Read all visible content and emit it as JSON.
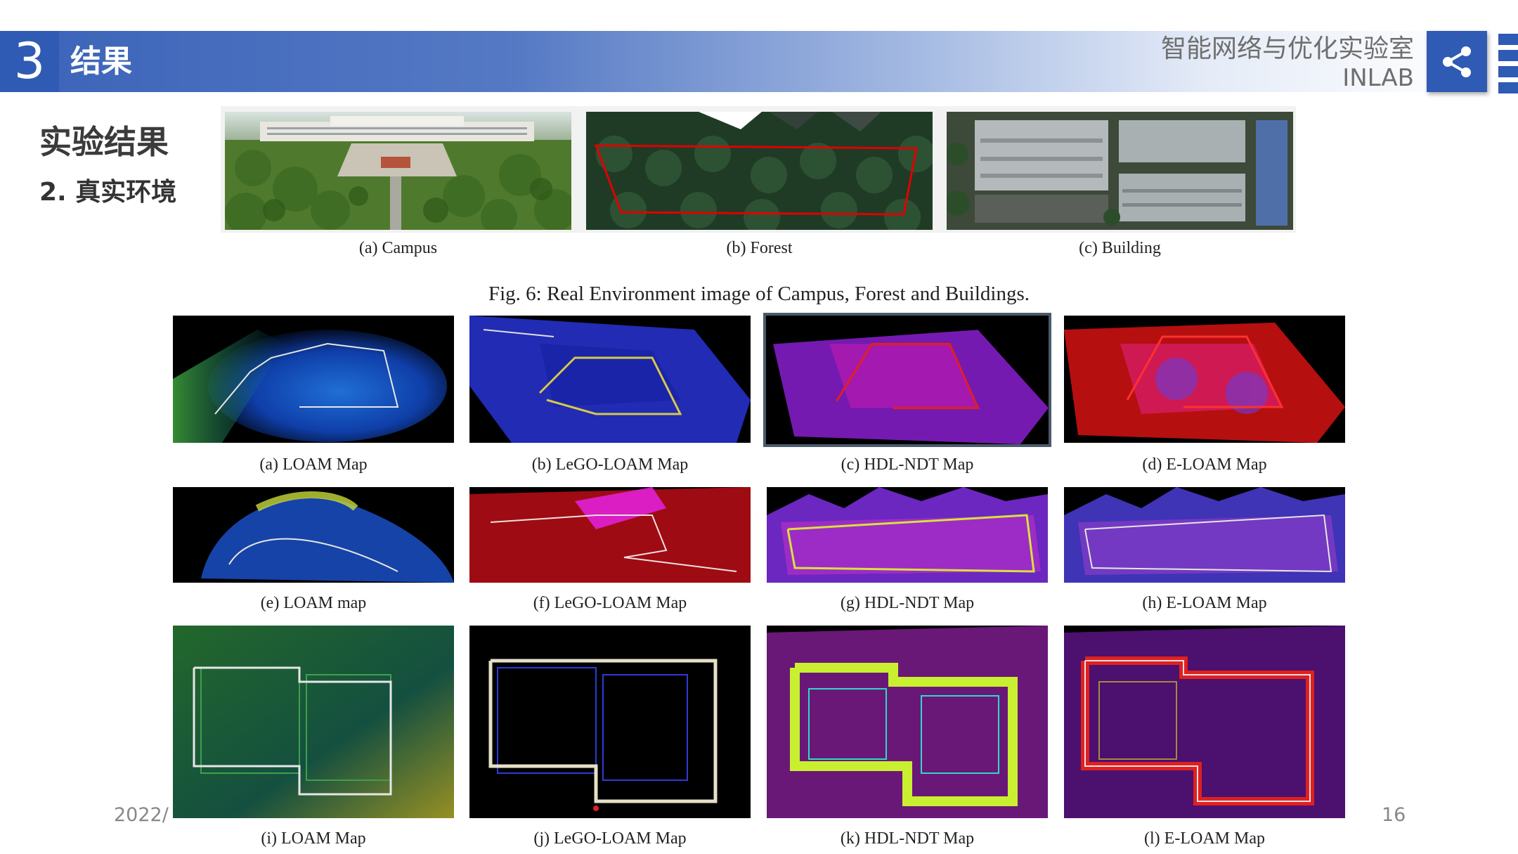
{
  "header": {
    "section_number": "3",
    "section_title": "结果",
    "lab_name": "智能网络与优化实验室",
    "lab_abbr": "INLAB",
    "share_icon": "share-icon",
    "brand_color": "#2f5bb5"
  },
  "page": {
    "title": "实验结果",
    "subtitle": "2. 真实环境"
  },
  "figure6": {
    "captions": [
      "(a)  Campus",
      "(b)  Forest",
      "(c)  Building"
    ],
    "title": "Fig. 6: Real Environment image of Campus, Forest and Buildings."
  },
  "figure7": {
    "captions": [
      "(a)  LOAM Map",
      "(b)  LeGO-LOAM Map",
      "(c)  HDL-NDT Map",
      "(d)  E-LOAM Map",
      "(e)  LOAM map",
      "(f)  LeGO-LOAM Map",
      "(g)  HDL-NDT Map",
      "(h)  E-LOAM Map",
      "(i)  LOAM Map",
      "(j)  LeGO-LOAM Map",
      "(k)  HDL-NDT Map",
      "(l)  E-LOAM Map"
    ]
  },
  "footer": {
    "date": "2022/",
    "page_number": "16"
  }
}
